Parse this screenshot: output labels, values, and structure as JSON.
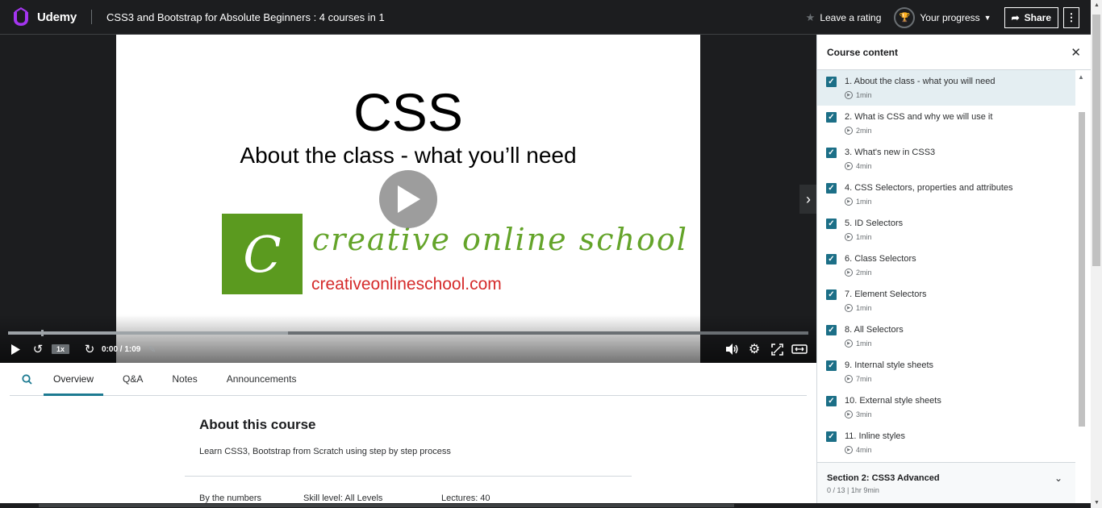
{
  "header": {
    "logo_text": "Udemy",
    "course_title": "CSS3 and Bootstrap for Absolute Beginners : 4 courses in 1",
    "rating_label": "Leave a rating",
    "progress_label": "Your progress",
    "share_label": "Share"
  },
  "video": {
    "slide_title": "CSS",
    "slide_subtitle": "About the class - what you’ll need",
    "logo_letter": "C",
    "logo_script": "creative online school",
    "logo_url": "creativeonlineschool.com",
    "speed": "1x",
    "time": "0:00 / 1:09",
    "progress_fraction": 0.0,
    "buffered_fraction": 0.35
  },
  "tabs": {
    "items": [
      "Overview",
      "Q&A",
      "Notes",
      "Announcements"
    ],
    "active": "Overview"
  },
  "about": {
    "heading": "About this course",
    "description": "Learn CSS3, Bootstrap from Scratch using step by step process",
    "numbers_label": "By the numbers",
    "skill_level": "Skill level: All Levels",
    "lectures": "Lectures: 40"
  },
  "sidebar": {
    "title": "Course content",
    "lectures": [
      {
        "title": "1. About the class - what you will need",
        "duration": "1min",
        "active": true
      },
      {
        "title": "2. What is CSS and why we will use it",
        "duration": "2min"
      },
      {
        "title": "3. What's new in CSS3",
        "duration": "4min"
      },
      {
        "title": "4. CSS Selectors, properties and attributes",
        "duration": "1min"
      },
      {
        "title": "5. ID Selectors",
        "duration": "1min"
      },
      {
        "title": "6. Class Selectors",
        "duration": "2min"
      },
      {
        "title": "7. Element Selectors",
        "duration": "1min"
      },
      {
        "title": "8. All Selectors",
        "duration": "1min"
      },
      {
        "title": "9. Internal style sheets",
        "duration": "7min"
      },
      {
        "title": "10. External style sheets",
        "duration": "3min"
      },
      {
        "title": "11. Inline styles",
        "duration": "4min"
      }
    ],
    "section": {
      "title": "Section 2: CSS3 Advanced",
      "meta": "0 / 13 | 1hr 9min"
    }
  },
  "colors": {
    "accent": "#1c7a91",
    "checkbox": "#1c6f87",
    "header_bg": "#1c1d1f",
    "logo_green": "#5b9a1f",
    "url_red": "#d52b2b"
  }
}
